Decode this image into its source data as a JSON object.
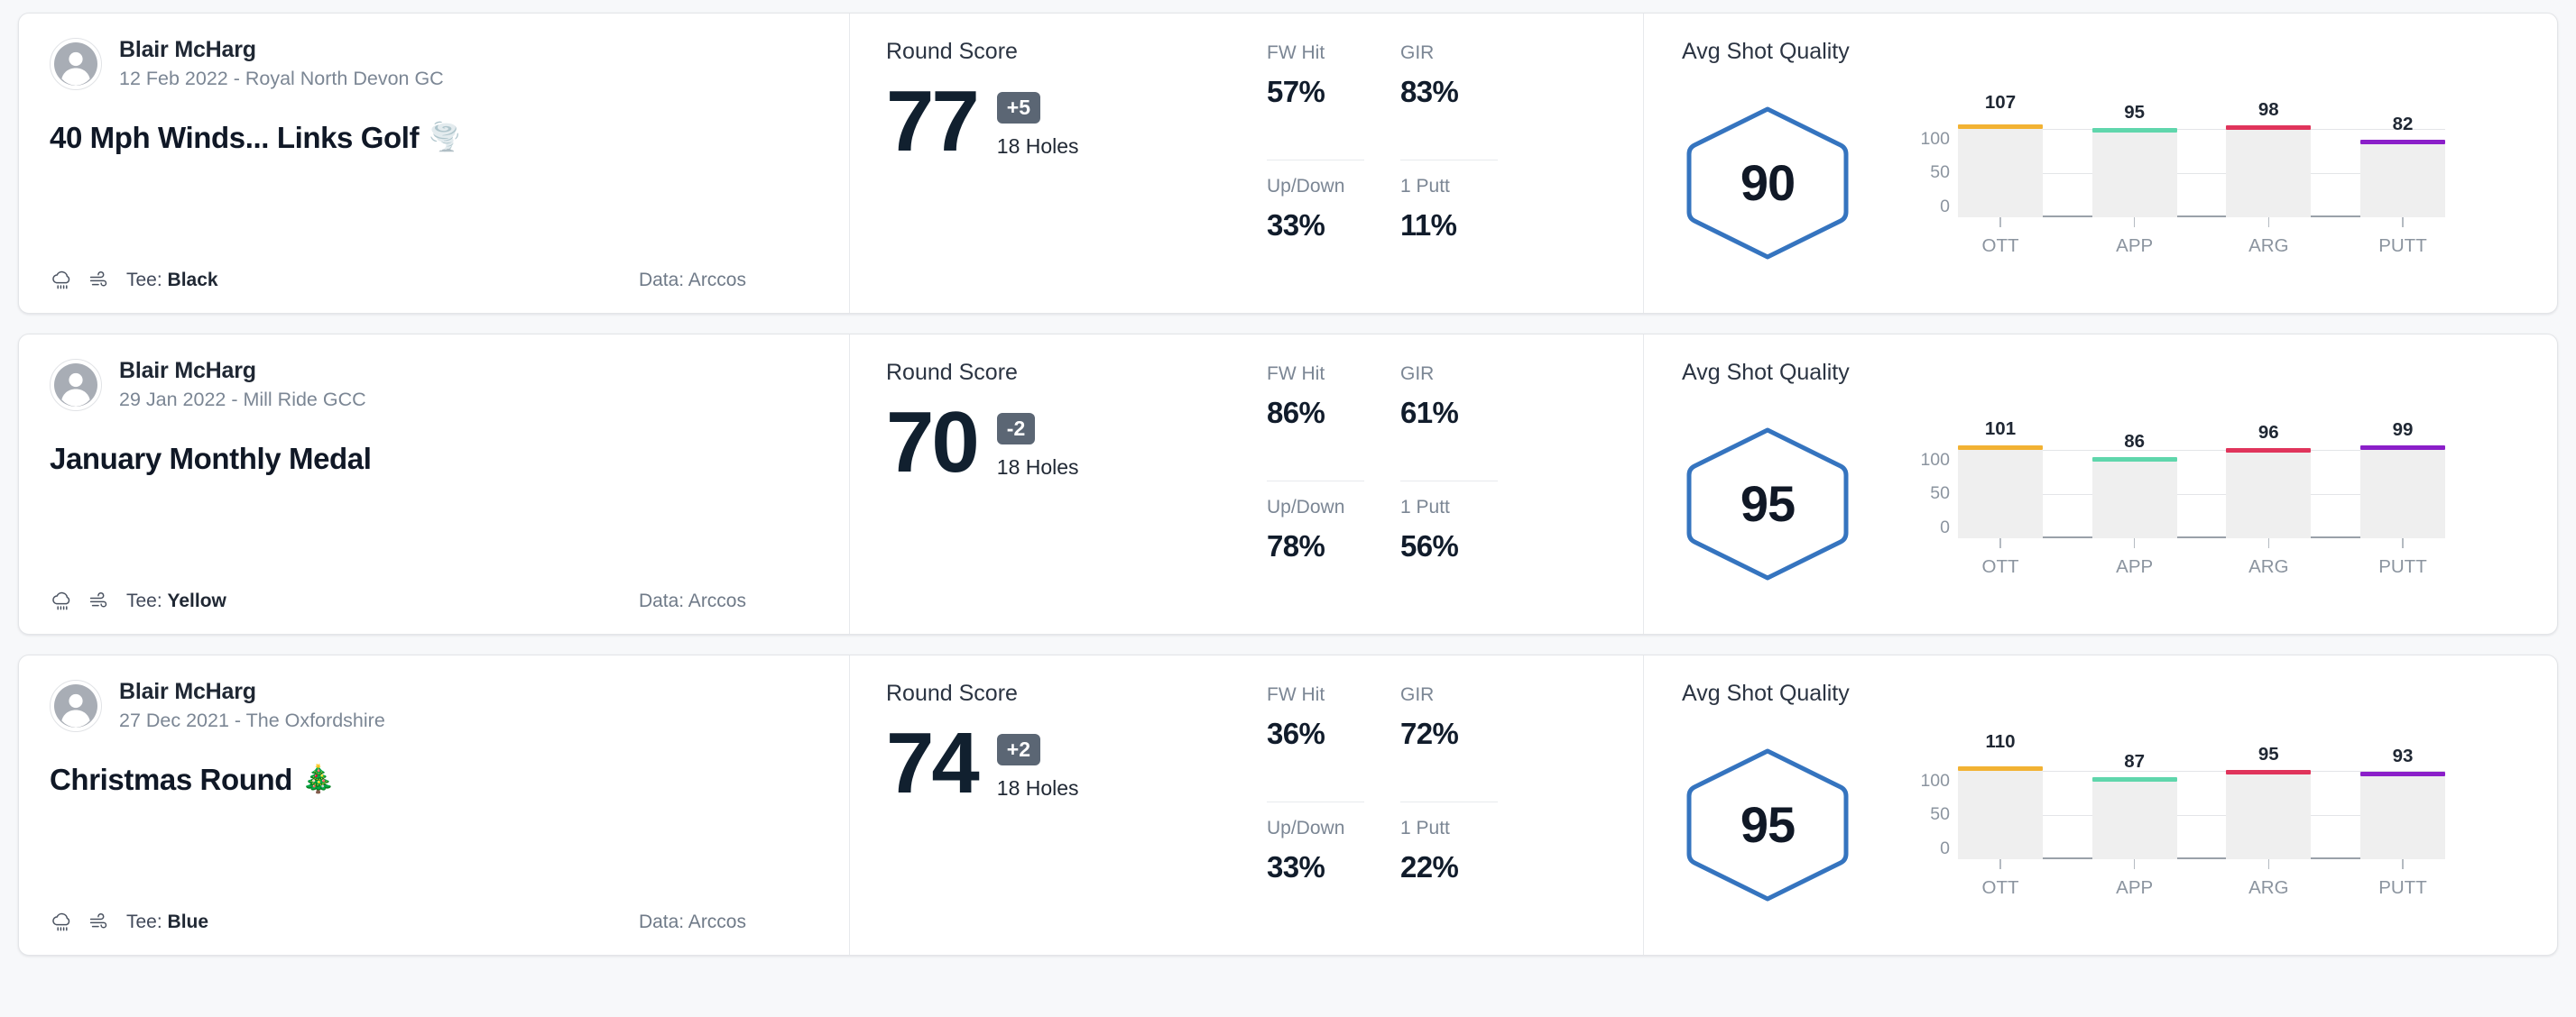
{
  "labels": {
    "round_score": "Round Score",
    "holes": "18 Holes",
    "avg_shot_quality": "Avg Shot Quality",
    "tee_prefix": "Tee: ",
    "data_prefix": "Data: Arccos",
    "stat_fw": "FW Hit",
    "stat_gir": "GIR",
    "stat_updown": "Up/Down",
    "stat_1putt": "1 Putt"
  },
  "colors": {
    "ott": "#F2B233",
    "app": "#5FD6AC",
    "arg": "#E0345B",
    "putt": "#8B1FC9",
    "hexagon": "#3574BF",
    "diff_badge": "#5B6674",
    "bar_track": "#EFEFEF"
  },
  "icons": {
    "avatar": "user-avatar-icon",
    "weather": "rain-cloud-icon",
    "wind": "wind-icon"
  },
  "rounds": [
    {
      "player": "Blair McHarg",
      "meta": "12 Feb 2022 - Royal North Devon GC",
      "title": "40 Mph Winds... Links Golf",
      "title_emoji": "🌪️",
      "tee": "Black",
      "data_source": "Data: Arccos",
      "score": "77",
      "diff": "+5",
      "holes": "18 Holes",
      "stats": {
        "fw": "57%",
        "gir": "83%",
        "updown": "33%",
        "putt1": "11%"
      },
      "avg_quality": "90",
      "chart_data": {
        "type": "bar",
        "title": "Avg Shot Quality",
        "categories": [
          "OTT",
          "APP",
          "ARG",
          "PUTT"
        ],
        "values": [
          107,
          95,
          98,
          82
        ],
        "colors": [
          "#F2B233",
          "#5FD6AC",
          "#E0345B",
          "#8B1FC9"
        ],
        "ylim": [
          0,
          120
        ],
        "yticks": [
          0,
          50,
          100
        ],
        "ylabel": "",
        "xlabel": "",
        "grid": true,
        "legend": "none"
      }
    },
    {
      "player": "Blair McHarg",
      "meta": "29 Jan 2022 - Mill Ride GCC",
      "title": "January Monthly Medal",
      "title_emoji": "",
      "tee": "Yellow",
      "data_source": "Data: Arccos",
      "score": "70",
      "diff": "-2",
      "holes": "18 Holes",
      "stats": {
        "fw": "86%",
        "gir": "61%",
        "updown": "78%",
        "putt1": "56%"
      },
      "avg_quality": "95",
      "chart_data": {
        "type": "bar",
        "title": "Avg Shot Quality",
        "categories": [
          "OTT",
          "APP",
          "ARG",
          "PUTT"
        ],
        "values": [
          101,
          86,
          96,
          99
        ],
        "colors": [
          "#F2B233",
          "#5FD6AC",
          "#E0345B",
          "#8B1FC9"
        ],
        "ylim": [
          0,
          120
        ],
        "yticks": [
          0,
          50,
          100
        ],
        "ylabel": "",
        "xlabel": "",
        "grid": true,
        "legend": "none"
      }
    },
    {
      "player": "Blair McHarg",
      "meta": "27 Dec 2021 - The Oxfordshire",
      "title": "Christmas Round",
      "title_emoji": "🎄",
      "tee": "Blue",
      "data_source": "Data: Arccos",
      "score": "74",
      "diff": "+2",
      "holes": "18 Holes",
      "stats": {
        "fw": "36%",
        "gir": "72%",
        "updown": "33%",
        "putt1": "22%"
      },
      "avg_quality": "95",
      "chart_data": {
        "type": "bar",
        "title": "Avg Shot Quality",
        "categories": [
          "OTT",
          "APP",
          "ARG",
          "PUTT"
        ],
        "values": [
          110,
          87,
          95,
          93
        ],
        "colors": [
          "#F2B233",
          "#5FD6AC",
          "#E0345B",
          "#8B1FC9"
        ],
        "ylim": [
          0,
          120
        ],
        "yticks": [
          0,
          50,
          100
        ],
        "ylabel": "",
        "xlabel": "",
        "grid": true,
        "legend": "none"
      }
    }
  ]
}
